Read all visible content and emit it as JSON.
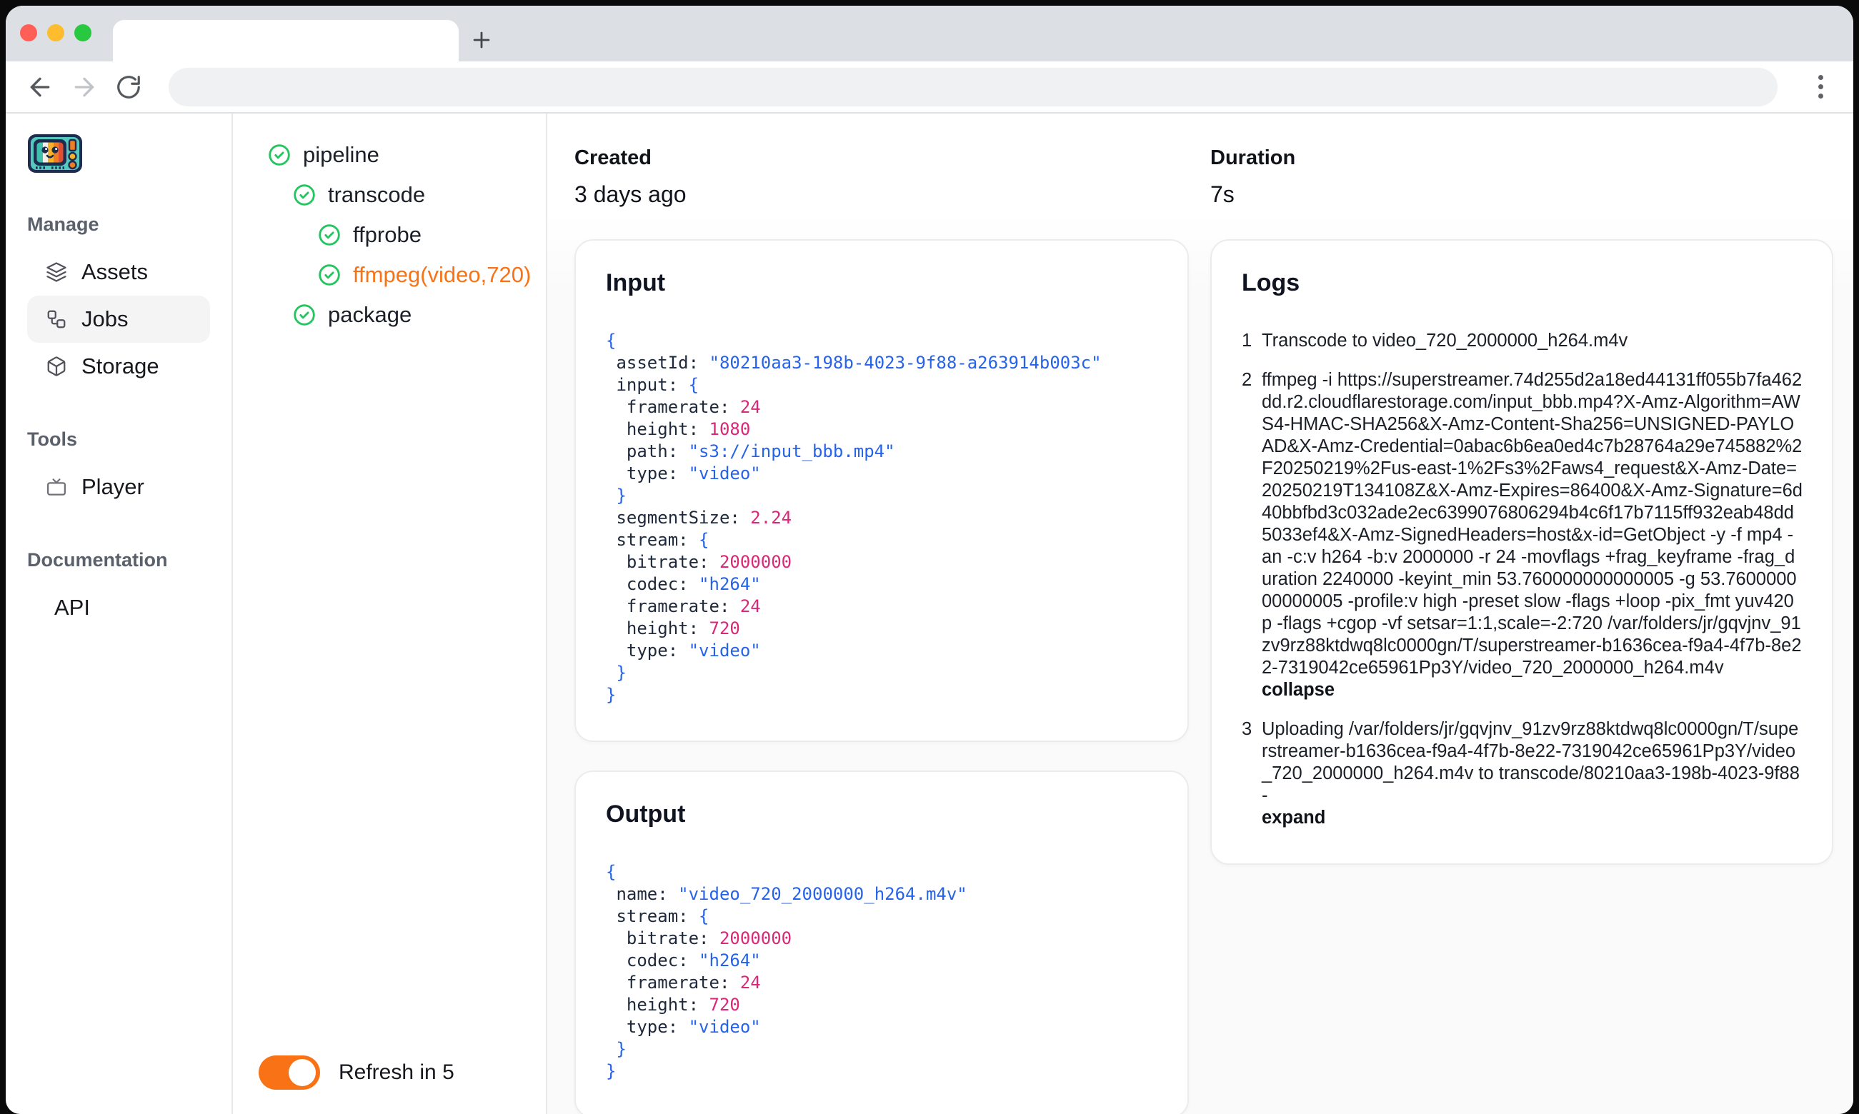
{
  "colors": {
    "accent_orange": "#f97316",
    "success_green": "#22c55e",
    "code_blue": "#2563eb",
    "code_pink": "#db2777",
    "traffic_close": "#ff5f57",
    "traffic_minimize": "#febc2e",
    "traffic_zoom": "#28c840",
    "active_item_bg": "#f4f4f5"
  },
  "sidebar": {
    "sections": [
      {
        "title": "Manage",
        "items": [
          {
            "label": "Assets",
            "icon": "layers-icon",
            "active": false
          },
          {
            "label": "Jobs",
            "icon": "workflow-icon",
            "active": true
          },
          {
            "label": "Storage",
            "icon": "box-icon",
            "active": false
          }
        ]
      },
      {
        "title": "Tools",
        "items": [
          {
            "label": "Player",
            "icon": "tv-icon",
            "active": false
          }
        ]
      },
      {
        "title": "Documentation",
        "items": [
          {
            "label": "API",
            "icon": null,
            "active": false
          }
        ]
      }
    ]
  },
  "tree": {
    "items": [
      {
        "label": "pipeline",
        "depth": 0,
        "status": "completed",
        "selected": false
      },
      {
        "label": "transcode",
        "depth": 1,
        "status": "completed",
        "selected": false
      },
      {
        "label": "ffprobe",
        "depth": 2,
        "status": "completed",
        "selected": false
      },
      {
        "label": "ffmpeg(video,720)",
        "depth": 2,
        "status": "completed",
        "selected": true
      },
      {
        "label": "package",
        "depth": 1,
        "status": "completed",
        "selected": false
      }
    ],
    "refresh": {
      "label": "Refresh in 5",
      "on": true
    }
  },
  "meta": {
    "created": {
      "label": "Created",
      "value": "3 days ago"
    },
    "duration": {
      "label": "Duration",
      "value": "7s"
    }
  },
  "input_panel": {
    "title": "Input",
    "code": [
      [
        [
          "p",
          "{"
        ]
      ],
      [
        [
          "k",
          " assetId: "
        ],
        [
          "s",
          "\"80210aa3-198b-4023-9f88-a263914b003c\""
        ]
      ],
      [
        [
          "k",
          " input: "
        ],
        [
          "p",
          "{"
        ]
      ],
      [
        [
          "k",
          "  framerate: "
        ],
        [
          "n",
          "24"
        ]
      ],
      [
        [
          "k",
          "  height: "
        ],
        [
          "n",
          "1080"
        ]
      ],
      [
        [
          "k",
          "  path: "
        ],
        [
          "s",
          "\"s3://input_bbb.mp4\""
        ]
      ],
      [
        [
          "k",
          "  type: "
        ],
        [
          "s",
          "\"video\""
        ]
      ],
      [
        [
          "p",
          " }"
        ]
      ],
      [
        [
          "k",
          " segmentSize: "
        ],
        [
          "n",
          "2.24"
        ]
      ],
      [
        [
          "k",
          " stream: "
        ],
        [
          "p",
          "{"
        ]
      ],
      [
        [
          "k",
          "  bitrate: "
        ],
        [
          "n",
          "2000000"
        ]
      ],
      [
        [
          "k",
          "  codec: "
        ],
        [
          "s",
          "\"h264\""
        ]
      ],
      [
        [
          "k",
          "  framerate: "
        ],
        [
          "n",
          "24"
        ]
      ],
      [
        [
          "k",
          "  height: "
        ],
        [
          "n",
          "720"
        ]
      ],
      [
        [
          "k",
          "  type: "
        ],
        [
          "s",
          "\"video\""
        ]
      ],
      [
        [
          "p",
          " }"
        ]
      ],
      [
        [
          "p",
          "}"
        ]
      ]
    ]
  },
  "output_panel": {
    "title": "Output",
    "code": [
      [
        [
          "p",
          "{"
        ]
      ],
      [
        [
          "k",
          " name: "
        ],
        [
          "s",
          "\"video_720_2000000_h264.m4v\""
        ]
      ],
      [
        [
          "k",
          " stream: "
        ],
        [
          "p",
          "{"
        ]
      ],
      [
        [
          "k",
          "  bitrate: "
        ],
        [
          "n",
          "2000000"
        ]
      ],
      [
        [
          "k",
          "  codec: "
        ],
        [
          "s",
          "\"h264\""
        ]
      ],
      [
        [
          "k",
          "  framerate: "
        ],
        [
          "n",
          "24"
        ]
      ],
      [
        [
          "k",
          "  height: "
        ],
        [
          "n",
          "720"
        ]
      ],
      [
        [
          "k",
          "  type: "
        ],
        [
          "s",
          "\"video\""
        ]
      ],
      [
        [
          "p",
          " }"
        ]
      ],
      [
        [
          "p",
          "}"
        ]
      ]
    ]
  },
  "logs_panel": {
    "title": "Logs",
    "entries": [
      {
        "num": "1",
        "text": "Transcode to video_720_2000000_h264.m4v",
        "action": ""
      },
      {
        "num": "2",
        "text": "ffmpeg -i https://superstreamer.74d255d2a18ed44131ff055b7fa462dd.r2.cloudflarestorage.com/input_bbb.mp4?X-Amz-Algorithm=AWS4-HMAC-SHA256&X-Amz-Content-Sha256=UNSIGNED-PAYLOAD&X-Amz-Credential=0abac6b6ea0ed4c7b28764a29e745882%2F20250219%2Fus-east-1%2Fs3%2Faws4_request&X-Amz-Date=20250219T134108Z&X-Amz-Expires=86400&X-Amz-Signature=6d40bbfbd3c032ade2ec6399076806294b4c6f17b7115ff932eab48dd5033ef4&X-Amz-SignedHeaders=host&x-id=GetObject -y -f mp4 -an -c:v h264 -b:v 2000000 -r 24 -movflags +frag_keyframe -frag_duration 2240000 -keyint_min 53.760000000000005 -g 53.760000000000005 -profile:v high -preset slow -flags +loop -pix_fmt yuv420p -flags +cgop -vf setsar=1:1,scale=-2:720 /var/folders/jr/gqvjnv_91zv9rz88ktdwq8lc0000gn/T/superstreamer-b1636cea-f9a4-4f7b-8e22-7319042ce65961Pp3Y/video_720_2000000_h264.m4v",
        "action": "collapse"
      },
      {
        "num": "3",
        "text": "Uploading /var/folders/jr/gqvjnv_91zv9rz88ktdwq8lc0000gn/T/superstreamer-b1636cea-f9a4-4f7b-8e22-7319042ce65961Pp3Y/video_720_2000000_h264.m4v to transcode/80210aa3-198b-4023-9f88-",
        "action": "expand"
      }
    ]
  }
}
